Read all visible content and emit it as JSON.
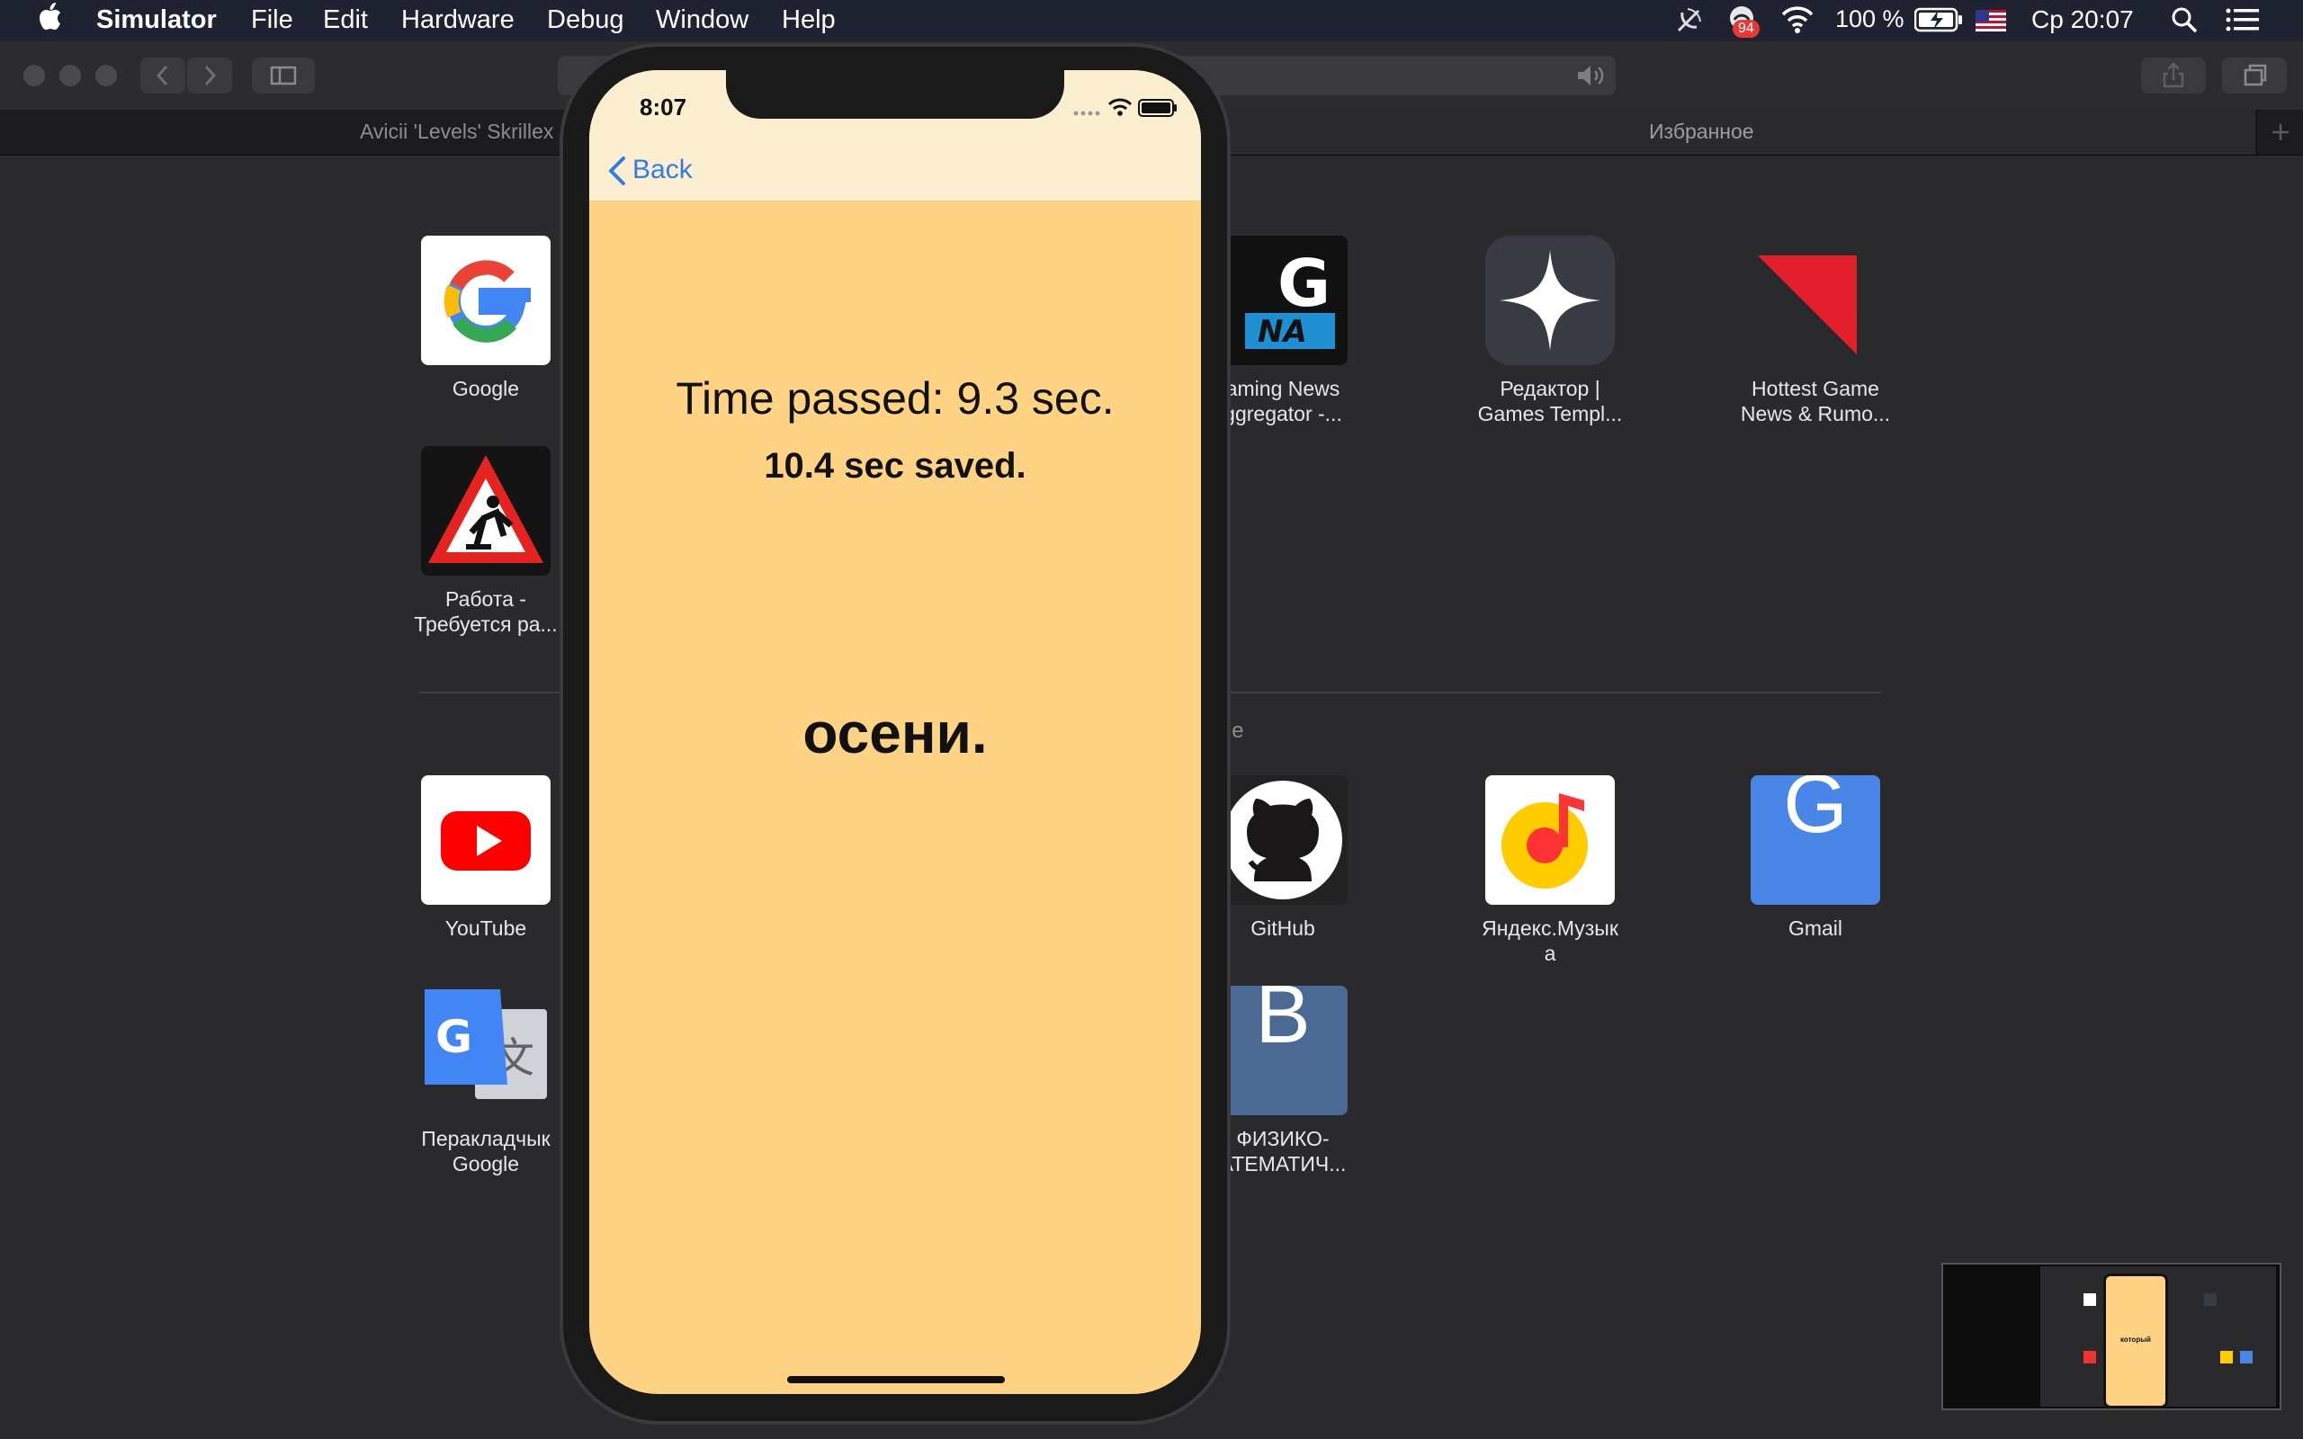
{
  "menubar": {
    "app": "Simulator",
    "menus": [
      "File",
      "Edit",
      "Hardware",
      "Debug",
      "Window",
      "Help"
    ],
    "notification_badge": "94",
    "battery": "100 %",
    "clock": "Ср 20:07"
  },
  "tabs": {
    "left": "Avicii 'Levels' Skrillex",
    "right": "Избранное"
  },
  "favorites_top": [
    {
      "label": "Google",
      "icon": "google-icon"
    },
    {
      "label": "Работа - Требуется ра...",
      "icon": "roadwork-sign-icon"
    },
    {
      "label": "aming News\nggregator -...",
      "icon": "gna-icon"
    },
    {
      "label": "Редактор |\nGames Templ...",
      "icon": "sparkle-star-icon"
    },
    {
      "label": "Hottest Game\nNews & Rumo...",
      "icon": "red-corner-icon"
    }
  ],
  "frequently_label_fragment": "ые",
  "favorites_bottom": [
    {
      "label": "YouTube",
      "icon": "youtube-icon"
    },
    {
      "label": "Перакладчык\nGoogle",
      "icon": "google-translate-icon"
    },
    {
      "label": "GitHub",
      "icon": "github-icon"
    },
    {
      "label": "ФИЗИКО-\nАТЕМАТИЧ...",
      "icon": "letter-b-icon",
      "letter": "B"
    },
    {
      "label": "Яндекс.Музык\nа",
      "icon": "yandex-music-icon"
    },
    {
      "label": "Gmail",
      "icon": "letter-g-icon",
      "letter": "G"
    }
  ],
  "phone": {
    "time": "8:07",
    "back": "Back",
    "time_passed": "Time passed: 9.3 sec.",
    "saved": "10.4 sec saved.",
    "word": "осени."
  },
  "thumbnail": {
    "word": "который"
  },
  "colors": {
    "accent": "#2f7ce4",
    "screen_bg": "#fed484",
    "navbar_bg": "#fcefcf"
  }
}
